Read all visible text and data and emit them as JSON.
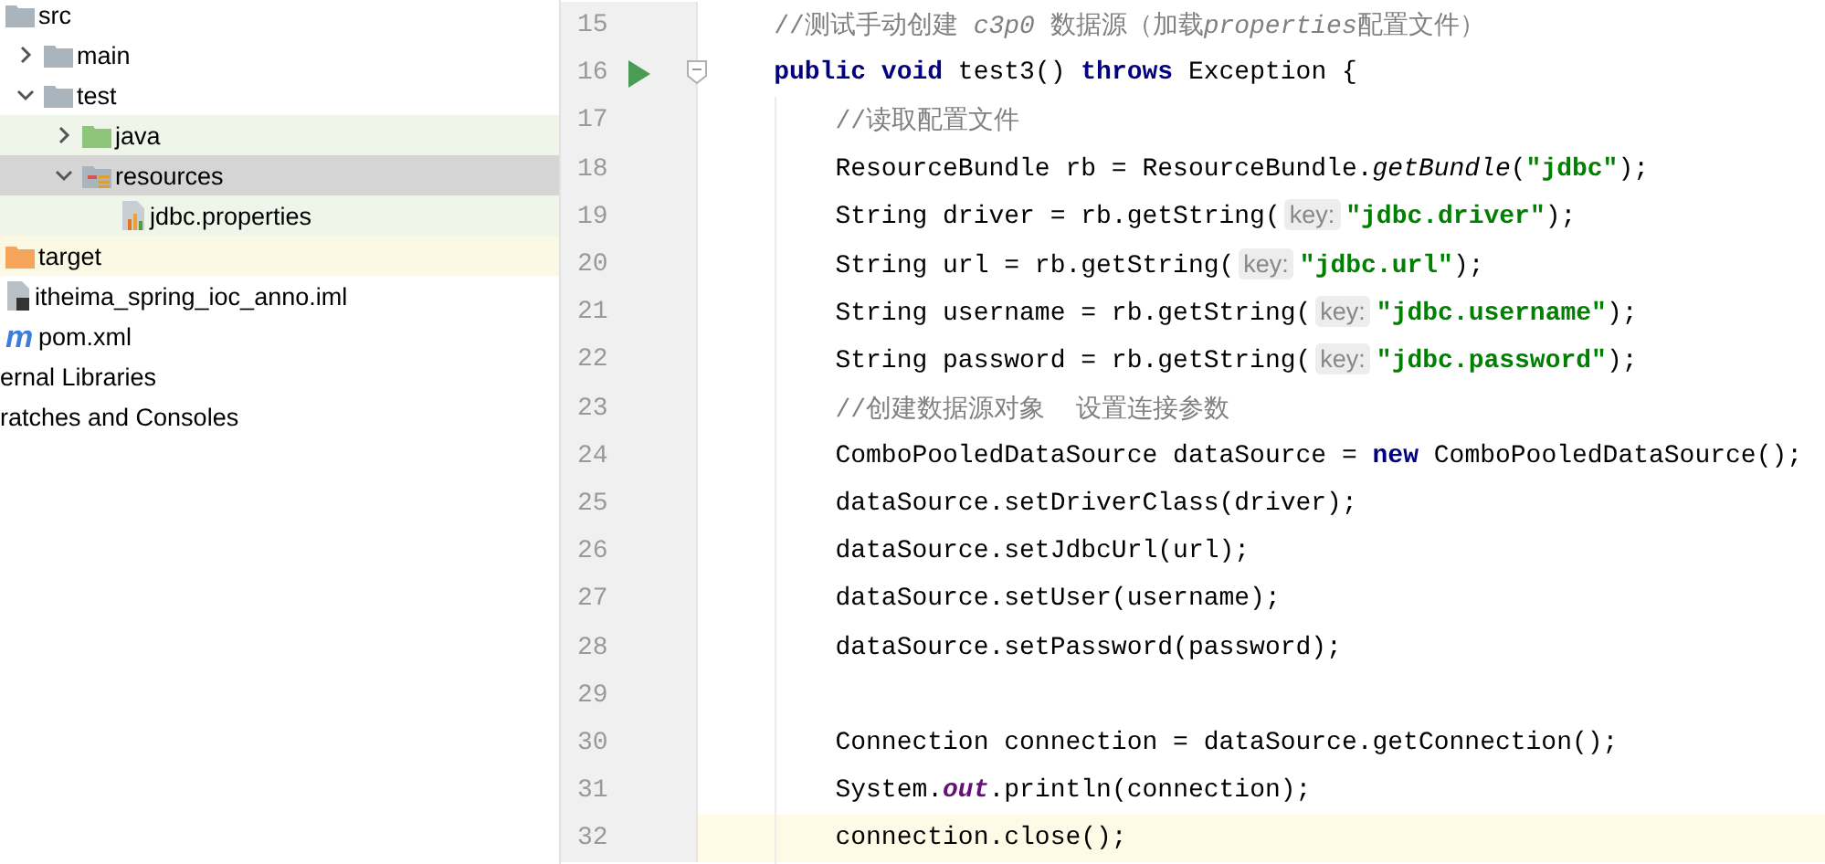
{
  "project_tree": [
    {
      "label": "src",
      "kind": "folder",
      "selected": false,
      "children": [
        {
          "label": "main",
          "kind": "folder",
          "expanded": false,
          "selected": false
        },
        {
          "label": "test",
          "kind": "folder",
          "expanded": true,
          "selected": false,
          "children": [
            {
              "label": "java",
              "kind": "test-folder",
              "expanded": false,
              "selected": false,
              "color": "#eff5e8"
            },
            {
              "label": "resources",
              "kind": "resources-folder",
              "expanded": true,
              "selected": true,
              "children": [
                {
                  "label": "jdbc.properties",
                  "kind": "properties",
                  "selected": false,
                  "color": "#eff5e8"
                }
              ]
            }
          ]
        }
      ]
    },
    {
      "label": "target",
      "kind": "excluded-folder",
      "selected": false,
      "color": "#fbf9e4"
    },
    {
      "label": "itheima_spring_ioc_anno.iml",
      "kind": "module-file",
      "selected": false
    },
    {
      "label": "pom.xml",
      "kind": "maven",
      "badge": "m",
      "selected": false
    },
    {
      "label": "ernal Libraries",
      "kind": "cut",
      "selected": false
    },
    {
      "label": "ratches and Consoles",
      "kind": "cut",
      "selected": false
    }
  ],
  "editor": {
    "lines": [
      {
        "number": "15",
        "runnable": false,
        "foldable": false,
        "current": false,
        "tokens": [
          {
            "kind": "comment",
            "text": "    //测试手动创建 "
          },
          {
            "kind": "comment-italic",
            "text": "c3p0"
          },
          {
            "kind": "comment",
            "text": " 数据源（加载"
          },
          {
            "kind": "comment-italic",
            "text": "properties"
          },
          {
            "kind": "comment",
            "text": "配置文件）"
          }
        ]
      },
      {
        "number": "16",
        "runnable": true,
        "foldable": true,
        "current": false,
        "tokens": [
          {
            "kind": "keyword",
            "text": "    public void"
          },
          {
            "kind": "text",
            "text": " test3() "
          },
          {
            "kind": "keyword",
            "text": "throws"
          },
          {
            "kind": "text",
            "text": " Exception {"
          }
        ]
      },
      {
        "number": "17",
        "runnable": false,
        "foldable": false,
        "current": false,
        "tokens": [
          {
            "kind": "comment",
            "text": "        //读取配置文件"
          }
        ]
      },
      {
        "number": "18",
        "runnable": false,
        "foldable": false,
        "current": false,
        "tokens": [
          {
            "kind": "text",
            "text": "        ResourceBundle rb = ResourceBundle."
          },
          {
            "kind": "italic",
            "text": "getBundle"
          },
          {
            "kind": "text",
            "text": "("
          },
          {
            "kind": "string",
            "text": "\"jdbc\""
          },
          {
            "kind": "text",
            "text": ");"
          }
        ]
      },
      {
        "number": "19",
        "runnable": false,
        "foldable": false,
        "current": false,
        "tokens": [
          {
            "kind": "text",
            "text": "        String driver = rb.getString("
          },
          {
            "kind": "hint",
            "text": "key:"
          },
          {
            "kind": "string",
            "text": "\"jdbc.driver\""
          },
          {
            "kind": "text",
            "text": ");"
          }
        ]
      },
      {
        "number": "20",
        "runnable": false,
        "foldable": false,
        "current": false,
        "tokens": [
          {
            "kind": "text",
            "text": "        String url = rb.getString("
          },
          {
            "kind": "hint",
            "text": "key:"
          },
          {
            "kind": "string",
            "text": "\"jdbc.url\""
          },
          {
            "kind": "text",
            "text": ");"
          }
        ]
      },
      {
        "number": "21",
        "runnable": false,
        "foldable": false,
        "current": false,
        "tokens": [
          {
            "kind": "text",
            "text": "        String username = rb.getString("
          },
          {
            "kind": "hint",
            "text": "key:"
          },
          {
            "kind": "string",
            "text": "\"jdbc.username\""
          },
          {
            "kind": "text",
            "text": ");"
          }
        ]
      },
      {
        "number": "22",
        "runnable": false,
        "foldable": false,
        "current": false,
        "tokens": [
          {
            "kind": "text",
            "text": "        String password = rb.getString("
          },
          {
            "kind": "hint",
            "text": "key:"
          },
          {
            "kind": "string",
            "text": "\"jdbc.password\""
          },
          {
            "kind": "text",
            "text": ");"
          }
        ]
      },
      {
        "number": "23",
        "runnable": false,
        "foldable": false,
        "current": false,
        "tokens": [
          {
            "kind": "comment",
            "text": "        //创建数据源对象  设置连接参数"
          }
        ]
      },
      {
        "number": "24",
        "runnable": false,
        "foldable": false,
        "current": false,
        "tokens": [
          {
            "kind": "text",
            "text": "        ComboPooledDataSource dataSource = "
          },
          {
            "kind": "keyword",
            "text": "new"
          },
          {
            "kind": "text",
            "text": " ComboPooledDataSource();"
          }
        ]
      },
      {
        "number": "25",
        "runnable": false,
        "foldable": false,
        "current": false,
        "tokens": [
          {
            "kind": "text",
            "text": "        dataSource.setDriverClass(driver);"
          }
        ]
      },
      {
        "number": "26",
        "runnable": false,
        "foldable": false,
        "current": false,
        "tokens": [
          {
            "kind": "text",
            "text": "        dataSource.setJdbcUrl(url);"
          }
        ]
      },
      {
        "number": "27",
        "runnable": false,
        "foldable": false,
        "current": false,
        "tokens": [
          {
            "kind": "text",
            "text": "        dataSource.setUser(username);"
          }
        ]
      },
      {
        "number": "28",
        "runnable": false,
        "foldable": false,
        "current": false,
        "tokens": [
          {
            "kind": "text",
            "text": "        dataSource.setPassword(password);"
          }
        ]
      },
      {
        "number": "29",
        "runnable": false,
        "foldable": false,
        "current": false
      },
      {
        "number": "30",
        "runnable": false,
        "foldable": false,
        "current": false,
        "tokens": [
          {
            "kind": "text",
            "text": "        Connection connection = dataSource.getConnection();"
          }
        ]
      },
      {
        "number": "31",
        "runnable": false,
        "foldable": false,
        "current": false,
        "tokens": [
          {
            "kind": "text",
            "text": "        System."
          },
          {
            "kind": "static",
            "text": "out"
          },
          {
            "kind": "text",
            "text": ".println(connection);"
          }
        ]
      },
      {
        "number": "32",
        "runnable": false,
        "foldable": false,
        "current": true,
        "tokens": [
          {
            "kind": "text",
            "text": "        connection.close();"
          }
        ]
      }
    ]
  }
}
